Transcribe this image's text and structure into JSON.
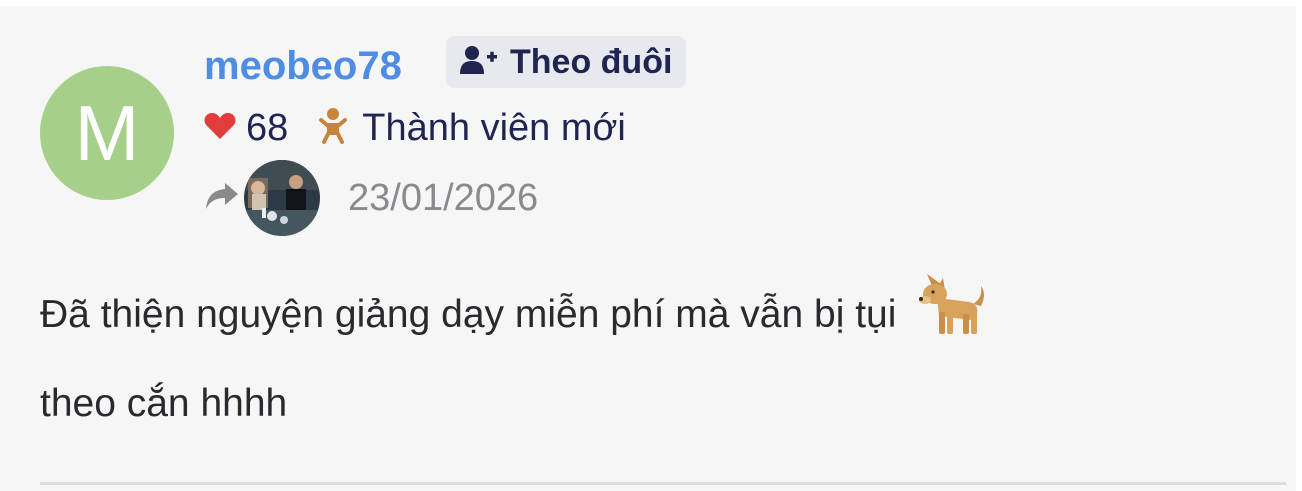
{
  "post": {
    "avatar_letter": "M",
    "username": "meobeo78",
    "follow_label": "Theo đuôi",
    "likes": "68",
    "rank_label": "Thành viên mới",
    "date": "23/01/2026",
    "body_line1": "Đã thiện nguyện giảng dạy miễn phí mà vẫn bị tụi",
    "body_line2": "theo cắn hhhh",
    "icons": {
      "follow": "user-plus-icon",
      "likes": "heart-icon",
      "rank": "baby-icon",
      "share": "share-arrow-icon",
      "emoji": "dog-emoji"
    },
    "colors": {
      "avatar_bg": "#a6cf8a",
      "username": "#4f8ce6",
      "heart": "#e23d3d",
      "rank_icon": "#c9843c",
      "text": "#1f2550"
    }
  }
}
